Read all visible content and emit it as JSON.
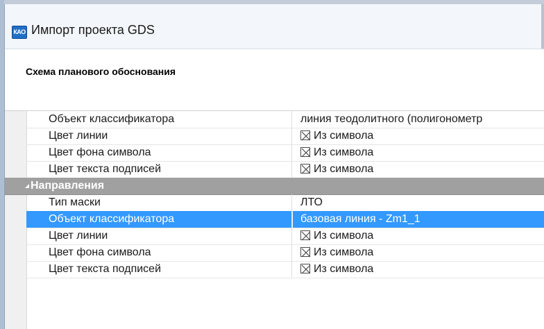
{
  "window": {
    "title": "Импорт проекта GDS",
    "icon": "app-logo-icon",
    "icon_text": "КАО"
  },
  "section": {
    "title": "Схема планового обоснования"
  },
  "properties_top": [
    {
      "name": "Объект классификатора",
      "value": "линия теодолитного (полигонометр",
      "swatch": false
    },
    {
      "name": "Цвет линии",
      "value": "Из символа",
      "swatch": true
    },
    {
      "name": "Цвет фона символа",
      "value": "Из символа",
      "swatch": true
    },
    {
      "name": "Цвет текста подписей",
      "value": "Из символа",
      "swatch": true
    }
  ],
  "group": {
    "label": "Направления",
    "expanded": true
  },
  "properties_group": [
    {
      "name": "Тип маски",
      "value": "ЛТО",
      "swatch": false,
      "selected": false
    },
    {
      "name": "Объект классификатора",
      "value": "базовая линия - Zm1_1",
      "swatch": false,
      "selected": true
    },
    {
      "name": "Цвет линии",
      "value": "Из символа",
      "swatch": true,
      "selected": false
    },
    {
      "name": "Цвет фона символа",
      "value": "Из символа",
      "swatch": true,
      "selected": false
    },
    {
      "name": "Цвет текста подписей",
      "value": "Из символа",
      "swatch": true,
      "selected": false
    }
  ],
  "colors": {
    "selection": "#3399ff",
    "group_header": "#a0a0a0"
  }
}
